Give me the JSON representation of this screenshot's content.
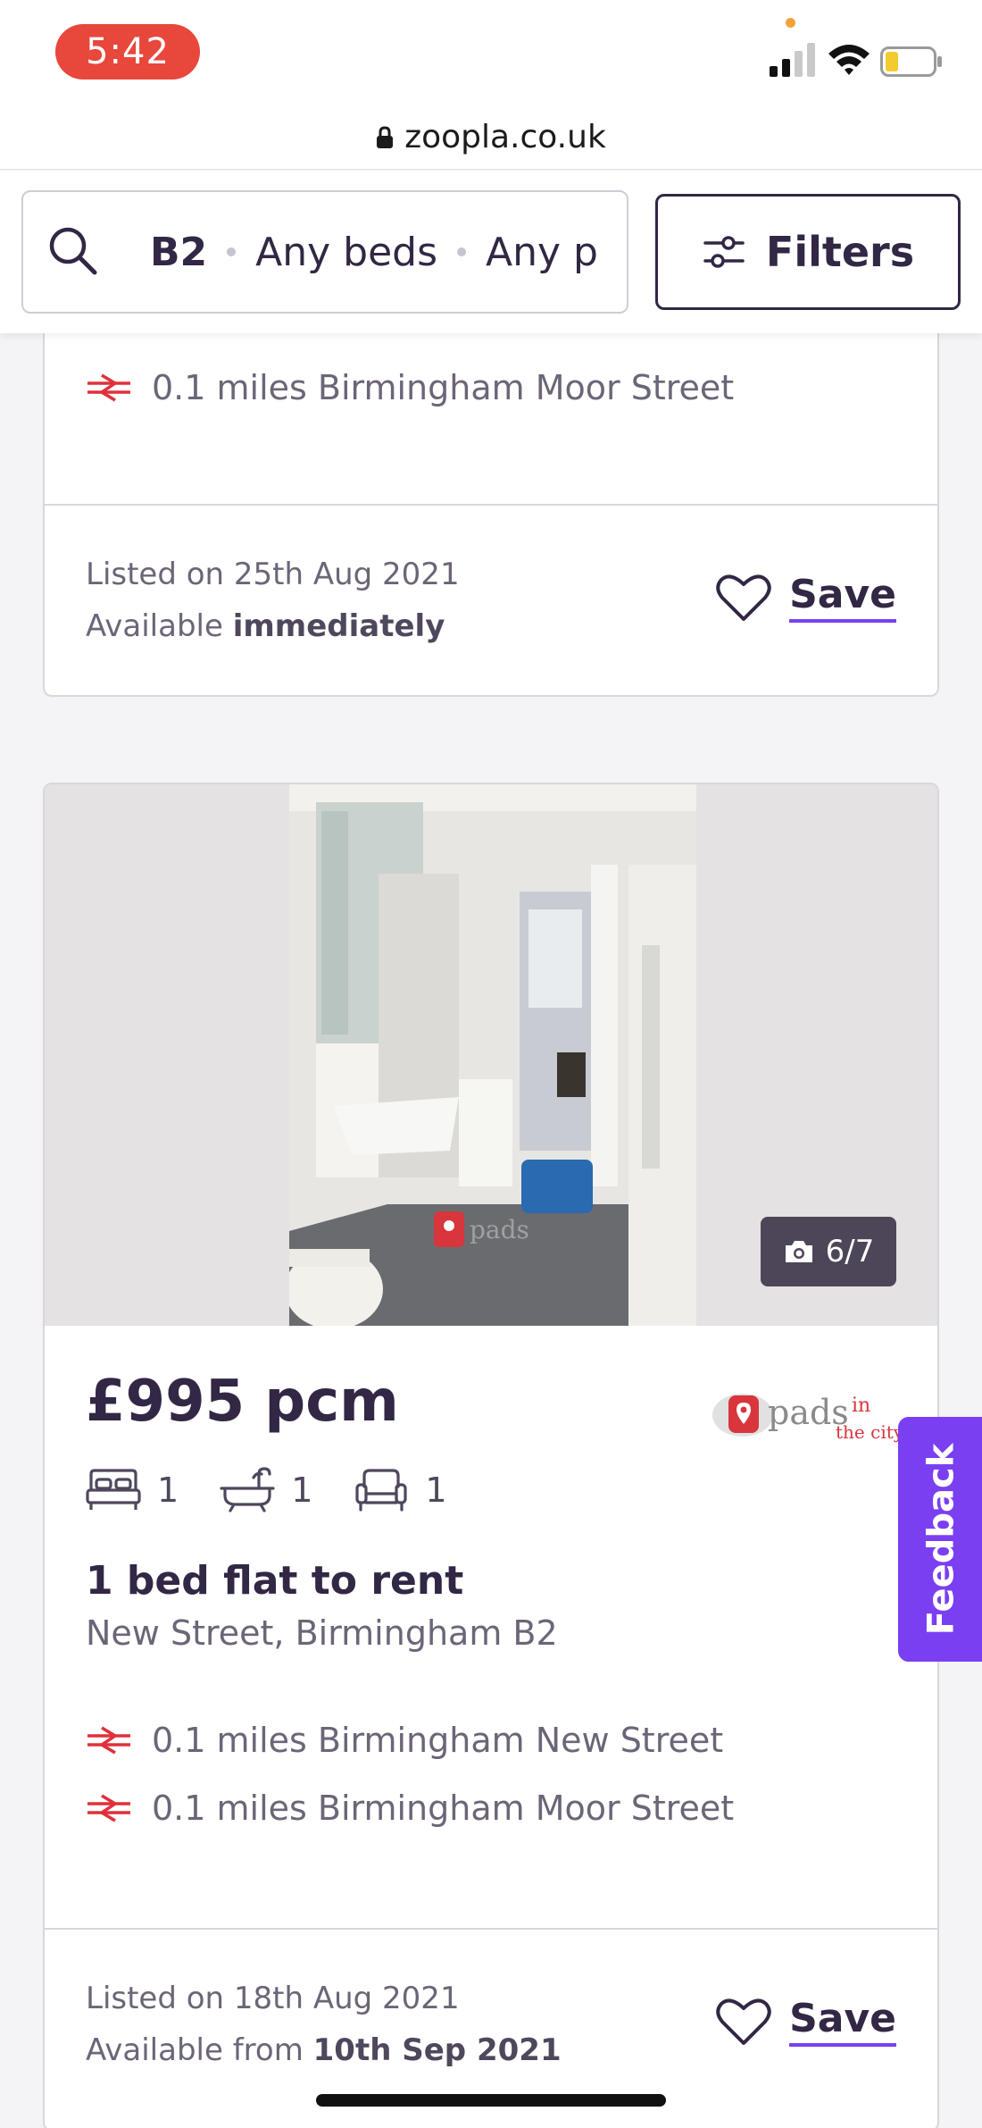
{
  "status_bar": {
    "time": "5:42"
  },
  "browser": {
    "url": "zoopla.co.uk"
  },
  "search": {
    "location": "B2",
    "beds": "Any beds",
    "price": "Any p",
    "filters_label": "Filters"
  },
  "listings": [
    {
      "stations": [
        "0.1 miles Birmingham Moor Street"
      ],
      "listed_on": "Listed on 25th Aug 2021",
      "available_prefix": "Available",
      "available_value": "immediately",
      "save_label": "Save"
    },
    {
      "photo_count": "6/7",
      "price": "£995 pcm",
      "beds": "1",
      "baths": "1",
      "receptions": "1",
      "title": "1 bed flat to rent",
      "address": "New Street, Birmingham B2",
      "stations": [
        "0.1 miles Birmingham New Street",
        "0.1 miles Birmingham Moor Street"
      ],
      "listed_on": "Listed on 18th Aug 2021",
      "available_prefix": "Available from",
      "available_value": "10th Sep 2021",
      "save_label": "Save",
      "agent_logo": {
        "text_main": "pads",
        "text_in": "in",
        "text_sub": "the city"
      }
    }
  ],
  "feedback_label": "Feedback",
  "colors": {
    "brand_purple": "#7b3ff2",
    "text_dark": "#322744",
    "rail_red": "#e0303b",
    "time_pill": "#e8473b"
  },
  "icons": [
    "search-icon",
    "filters-icon",
    "rail-icon",
    "heart-icon",
    "camera-icon",
    "bed-icon",
    "bath-icon",
    "sofa-icon",
    "lock-icon"
  ]
}
